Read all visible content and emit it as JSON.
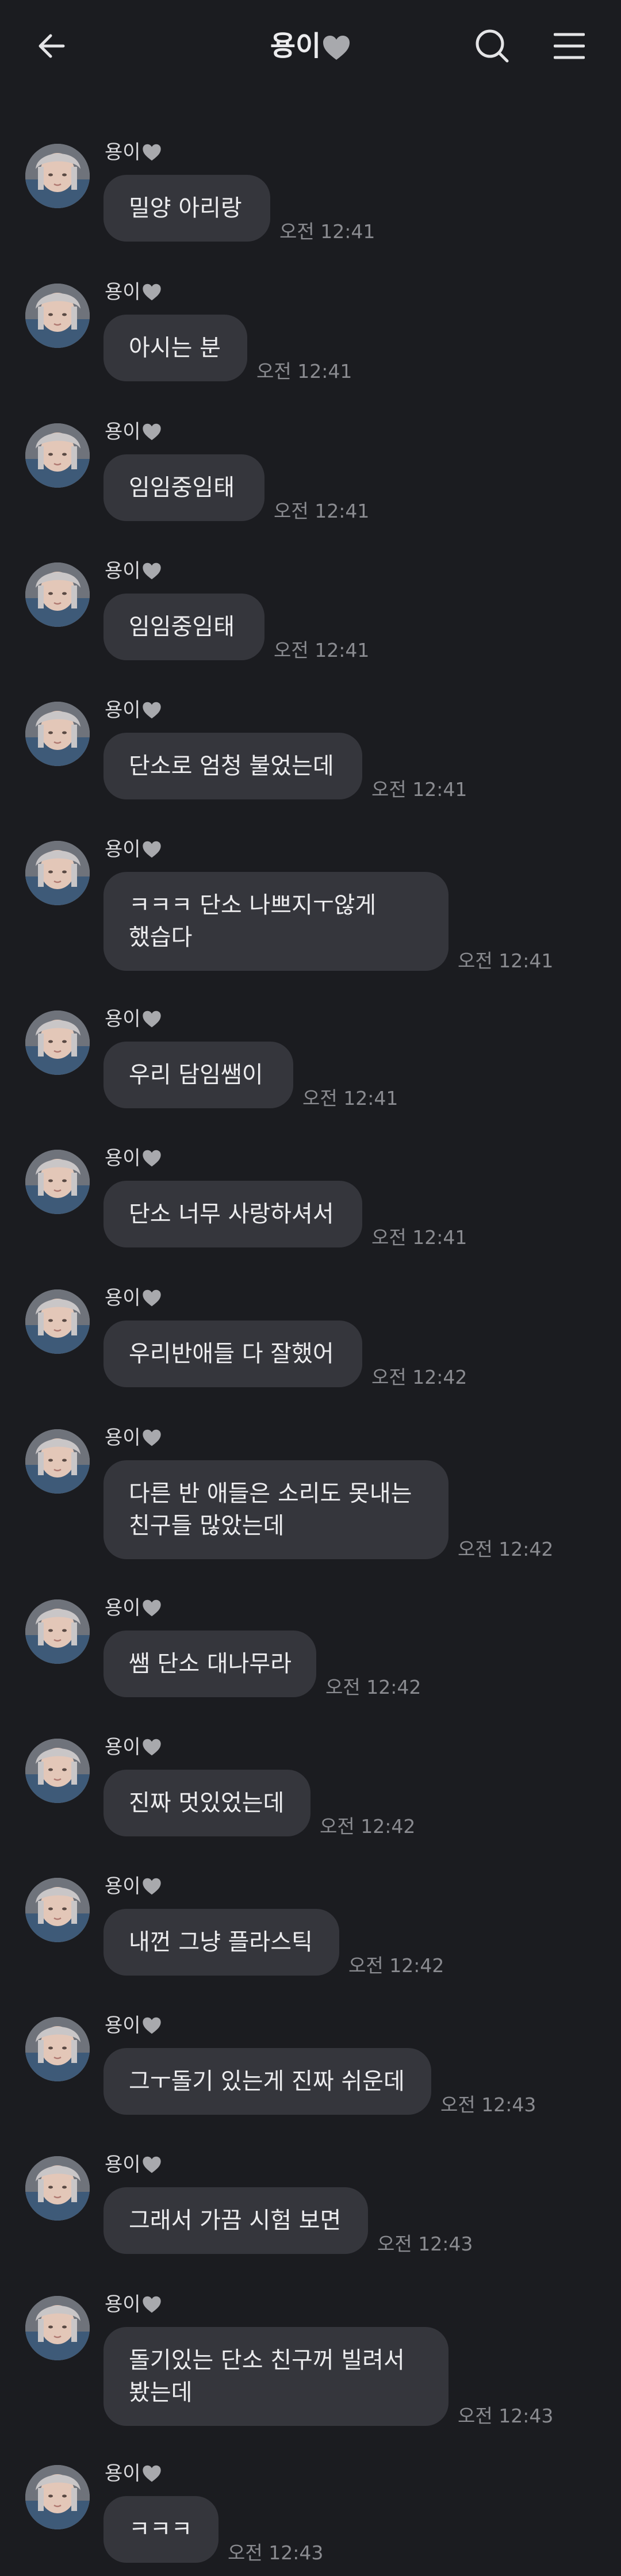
{
  "header": {
    "title": "용이",
    "back_icon": "arrow-left-icon",
    "search_icon": "search-icon",
    "menu_icon": "hamburger-menu-icon",
    "heart_icon": "grey-heart-emoji"
  },
  "colors": {
    "background": "#1b1c20",
    "bubble": "#35363c",
    "text": "#ececee",
    "timestamp": "#8a8b90"
  },
  "messages": [
    {
      "sender": "용이",
      "text": "밀양 아리랑",
      "time": "오전 12:41"
    },
    {
      "sender": "용이",
      "text": "아시는 분",
      "time": "오전 12:41"
    },
    {
      "sender": "용이",
      "text": "임임중임태",
      "time": "오전 12:41"
    },
    {
      "sender": "용이",
      "text": "임임중임태",
      "time": "오전 12:41"
    },
    {
      "sender": "용이",
      "text": "단소로 엄청 불었는데",
      "time": "오전 12:41"
    },
    {
      "sender": "용이",
      "line1": "ㅋㅋㅋ 단소 나쁘지ㅜ않게",
      "line2": "했습다",
      "time": "오전 12:41"
    },
    {
      "sender": "용이",
      "text": "우리 담임쌤이",
      "time": "오전 12:41"
    },
    {
      "sender": "용이",
      "text": "단소 너무 사랑하셔서",
      "time": "오전 12:41"
    },
    {
      "sender": "용이",
      "text": "우리반애들 다 잘했어",
      "time": "오전 12:42"
    },
    {
      "sender": "용이",
      "line1": "다른 반 애들은 소리도 못내는",
      "line2": "친구들 많았는데",
      "time": "오전 12:42"
    },
    {
      "sender": "용이",
      "text": "쌤 단소 대나무라",
      "time": "오전 12:42"
    },
    {
      "sender": "용이",
      "text": "진짜 멋있었는데",
      "time": "오전 12:42"
    },
    {
      "sender": "용이",
      "text": "내껀 그냥 플라스틱",
      "time": "오전 12:42"
    },
    {
      "sender": "용이",
      "text": "그ㅜ돌기 있는게 진짜 쉬운데",
      "time": "오전 12:43"
    },
    {
      "sender": "용이",
      "text": "그래서 가끔 시험 보면",
      "time": "오전 12:43"
    },
    {
      "sender": "용이",
      "line1": "돌기있는 단소 친구꺼 빌려서",
      "line2": "봤는데",
      "time": "오전 12:43"
    },
    {
      "sender": "용이",
      "text": "ㅋㅋㅋ",
      "time": "오전 12:43"
    }
  ]
}
